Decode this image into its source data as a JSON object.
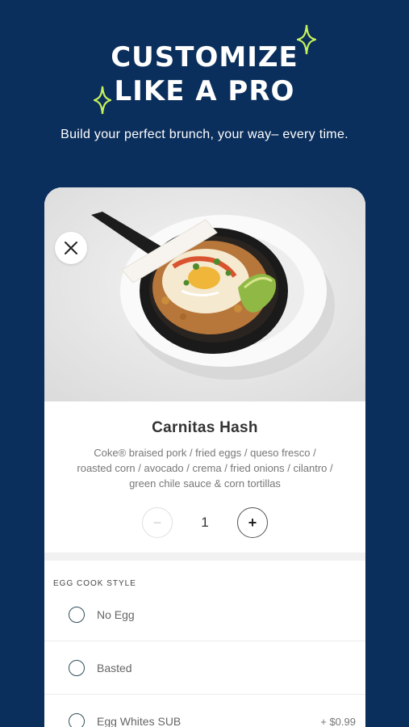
{
  "headline": {
    "line1": "CUSTOMIZE",
    "line2": "LIKE A PRO"
  },
  "subtitle": "Build your perfect brunch, your way– every time.",
  "colors": {
    "background": "#0b2f5c",
    "sparkle": "#c6f25a",
    "card": "#ffffff"
  },
  "product": {
    "close_icon": "close-icon",
    "name": "Carnitas Hash",
    "description": "Coke® braised pork / fried eggs / queso fresco / roasted corn / avocado / crema / fried onions / cilantro / green chile sauce & corn tortillas",
    "quantity": "1",
    "minus_label": "−",
    "plus_label": "+"
  },
  "egg_section": {
    "label": "EGG COOK STYLE",
    "options": [
      {
        "label": "No Egg",
        "price": ""
      },
      {
        "label": "Basted",
        "price": ""
      },
      {
        "label": "Egg Whites SUB",
        "price": "+ $0.99"
      }
    ]
  }
}
